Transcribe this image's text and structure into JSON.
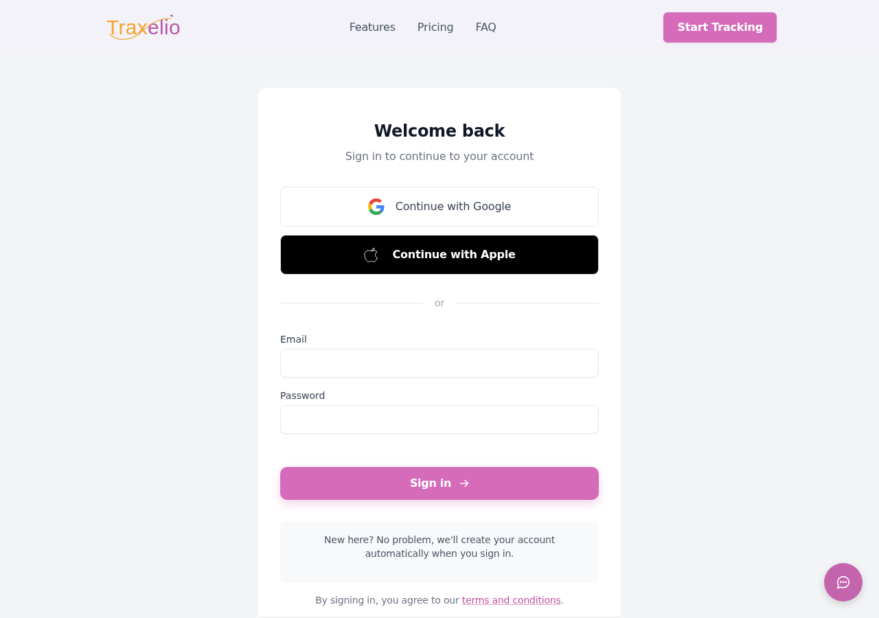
{
  "header": {
    "logo": {
      "parts": [
        {
          "text": "Trax",
          "color": "#f4a52b"
        },
        {
          "text": "elio",
          "color": "#b955a8"
        }
      ]
    },
    "nav_links": [
      "Features",
      "Pricing",
      "FAQ"
    ],
    "cta_button": "Start Tracking"
  },
  "login_card": {
    "title": "Welcome back",
    "subtitle": "Sign in to continue to your account",
    "social_buttons": [
      {
        "kind": "google",
        "label": "Continue with Google"
      },
      {
        "kind": "apple",
        "label": "Continue with Apple"
      }
    ],
    "divider": "or",
    "fields": [
      {
        "label": "Email"
      },
      {
        "label": "Password"
      }
    ],
    "submit_button": "Sign in",
    "info_note": "New here? No problem, we'll create your account automatically when you sign in.",
    "terms": {
      "text": "By signing in, you agree to our ",
      "link": "terms and conditions",
      "suffix": "."
    }
  }
}
